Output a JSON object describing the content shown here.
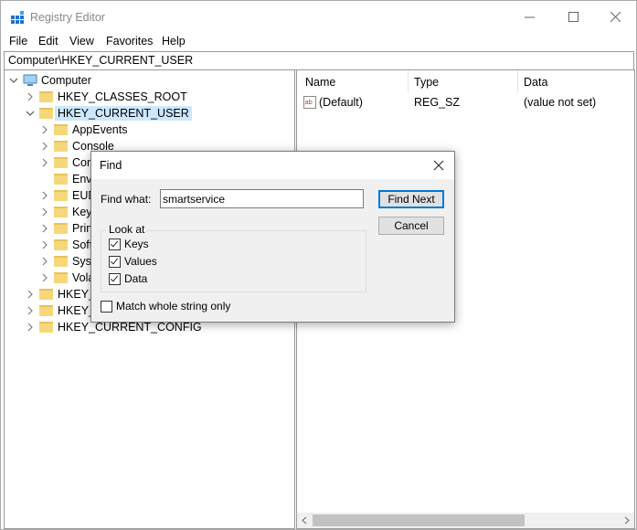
{
  "window": {
    "title": "Registry Editor"
  },
  "menu": [
    "File",
    "Edit",
    "View",
    "Favorites",
    "Help"
  ],
  "address": "Computer\\HKEY_CURRENT_USER",
  "tree": {
    "root": "Computer",
    "hives": [
      "HKEY_CLASSES_ROOT",
      "HKEY_CURRENT_USER",
      "HKEY_L",
      "HKEY_U",
      "HKEY_CURRENT_CONFIG"
    ],
    "hkcu_children": [
      "AppEvents",
      "Console",
      "Con",
      "Envi",
      "EUD",
      "Keyb",
      "Prin",
      "Soft",
      "Syst",
      "Vola"
    ]
  },
  "list": {
    "columns": [
      "Name",
      "Type",
      "Data"
    ],
    "rows": [
      {
        "name": "(Default)",
        "type": "REG_SZ",
        "data": "(value not set)"
      }
    ]
  },
  "find_dialog": {
    "title": "Find",
    "find_what_label": "Find what:",
    "find_what_value": "smartservice",
    "find_next": "Find Next",
    "cancel": "Cancel",
    "look_at": "Look at",
    "keys": "Keys",
    "values": "Values",
    "data": "Data",
    "match_whole": "Match whole string only"
  },
  "colors": {
    "selection": "#cce8ff",
    "accent": "#0078d7",
    "folder": "#f6d87b"
  }
}
